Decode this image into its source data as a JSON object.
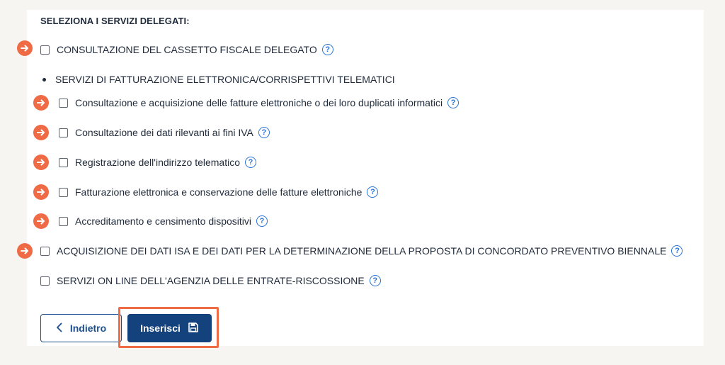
{
  "heading": "SELEZIONA I SERVIZI DELEGATI:",
  "services": {
    "cassetto": "CONSULTAZIONE DEL CASSETTO FISCALE DELEGATO",
    "fatturazione_group": "SERVIZI DI FATTURAZIONE ELETTRONICA/CORRISPETTIVI TELEMATICI",
    "sub": [
      "Consultazione e acquisizione delle fatture elettroniche o dei loro duplicati informatici",
      "Consultazione dei dati rilevanti ai fini IVA",
      "Registrazione dell'indirizzo telematico",
      "Fatturazione elettronica e conservazione delle fatture elettroniche",
      "Accreditamento e censimento dispositivi"
    ],
    "isa": "ACQUISIZIONE DEI DATI ISA E DEI DATI PER LA DETERMINAZIONE DELLA PROPOSTA DI CONCORDATO PREVENTIVO BIENNALE",
    "riscossione": "SERVIZI ON LINE DELL'AGENZIA DELLE ENTRATE-RISCOSSIONE"
  },
  "help_glyph": "?",
  "buttons": {
    "back": "Indietro",
    "insert": "Inserisci"
  },
  "icons": {
    "marker": "arrow-right-circle-icon",
    "help": "question-circle-icon",
    "back": "chevron-left-icon",
    "save": "floppy-disk-icon"
  },
  "colors": {
    "marker": "#ef6b45",
    "primary": "#13427d",
    "help": "#2a73d8",
    "background": "#f7f5f2"
  }
}
